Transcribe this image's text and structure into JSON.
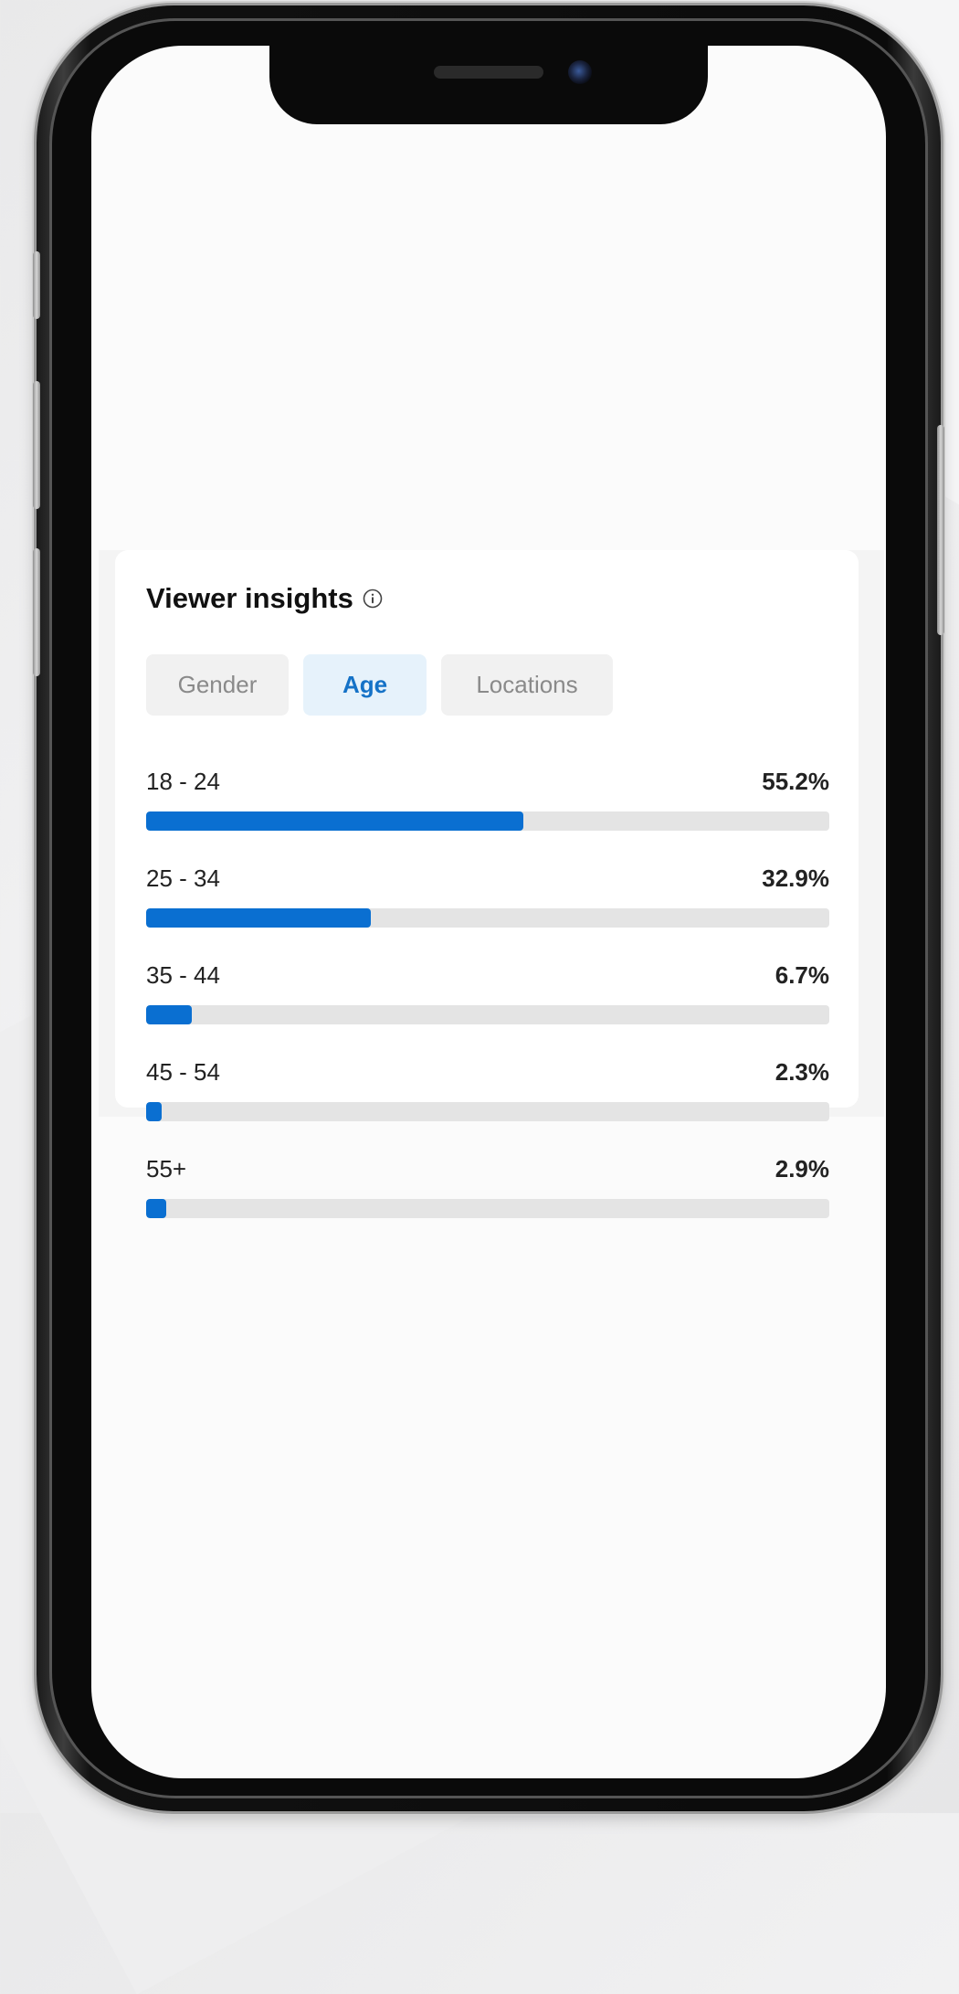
{
  "card": {
    "title": "Viewer insights",
    "info_icon": "info-circle-icon"
  },
  "tabs": [
    {
      "label": "Gender",
      "selected": false
    },
    {
      "label": "Age",
      "selected": true
    },
    {
      "label": "Locations",
      "selected": false
    }
  ],
  "age_rows": [
    {
      "label": "18 - 24",
      "value": "55.2%",
      "fraction": 0.552
    },
    {
      "label": "25 - 34",
      "value": "32.9%",
      "fraction": 0.329
    },
    {
      "label": "35 - 44",
      "value": "6.7%",
      "fraction": 0.067
    },
    {
      "label": "45 - 54",
      "value": "2.3%",
      "fraction": 0.023
    },
    {
      "label": "55+",
      "value": "2.9%",
      "fraction": 0.029
    }
  ],
  "colors": {
    "accent": "#0a6fd1",
    "selected_tab_bg": "#e6f2fb",
    "selected_tab_text": "#1572c7",
    "tab_bg": "#f1f1f1",
    "track": "#e4e4e4"
  }
}
